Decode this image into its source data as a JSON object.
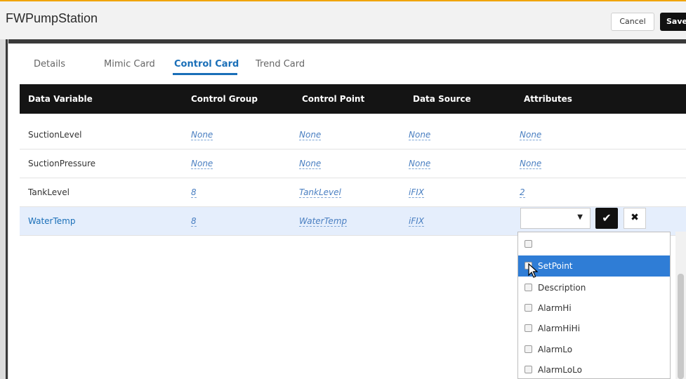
{
  "header": {
    "title": "FWPumpStation",
    "cancel_label": "Cancel",
    "save_label": "Save"
  },
  "tabs": [
    {
      "label": "Details",
      "active": false
    },
    {
      "label": "Mimic Card",
      "active": false
    },
    {
      "label": "Control Card",
      "active": true
    },
    {
      "label": "Trend Card",
      "active": false
    }
  ],
  "table": {
    "columns": [
      "Data Variable",
      "Control Group",
      "Control Point",
      "Data Source",
      "Attributes"
    ],
    "rows": [
      {
        "data_variable": "SuctionLevel",
        "control_group": "None",
        "control_point": "None",
        "data_source": "None",
        "attributes": "None"
      },
      {
        "data_variable": "SuctionPressure",
        "control_group": "None",
        "control_point": "None",
        "data_source": "None",
        "attributes": "None"
      },
      {
        "data_variable": "TankLevel",
        "control_group": "8",
        "control_point": "TankLevel",
        "data_source": "iFIX",
        "attributes": "2"
      },
      {
        "data_variable": "WaterTemp",
        "control_group": "8",
        "control_point": "WaterTemp",
        "data_source": "iFIX",
        "attributes": ""
      }
    ]
  },
  "attribute_editor": {
    "selected_value": "",
    "options": [
      "",
      "SetPoint",
      "Description",
      "AlarmHi",
      "AlarmHiHi",
      "AlarmLo",
      "AlarmLoLo"
    ],
    "highlighted_option": "SetPoint"
  },
  "icons": {
    "confirm": "check-icon",
    "cancel": "close-icon",
    "caret": "chevron-down-icon",
    "pointer": "mouse-cursor-icon"
  },
  "colors": {
    "accent_blue": "#1a6fb8",
    "header_black": "#141414",
    "highlight_blue": "#2f7dd6",
    "selected_row": "#e5eefc",
    "top_border_orange": "#f0a400"
  }
}
